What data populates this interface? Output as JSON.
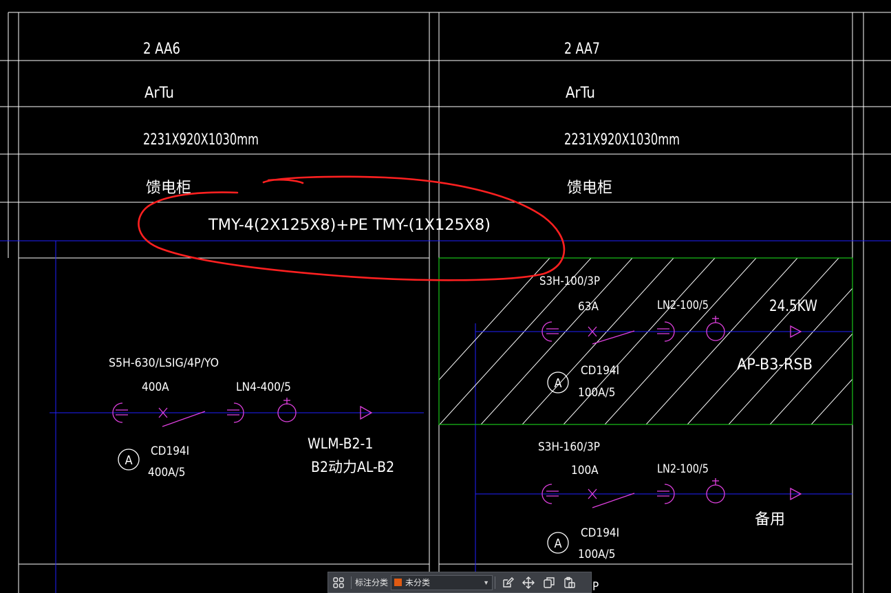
{
  "drawing": {
    "cabinet_ids": [
      "2 AA6",
      "2 AA7"
    ],
    "types": [
      "ArTu",
      "ArTu"
    ],
    "dimensions": [
      "2231X920X1030mm",
      "2231X920X1030mm"
    ],
    "functions": [
      "馈电柜",
      "馈电柜"
    ],
    "busbar_spec": "TMY-4(2X125X8)+PE TMY-(1X125X8)",
    "circuit_left": {
      "breaker": "S5H-630/LSIG/4P/YO",
      "current": "400A",
      "ct": "LN4-400/5",
      "meter_symbol": "A",
      "meter_model": "CD194I",
      "meter_ratio": "400A/5",
      "feeder": "WLM-B2-1",
      "destination": "B2动力AL-B2"
    },
    "circuit_right_1": {
      "breaker": "S3H-100/3P",
      "current": "63A",
      "ct": "LN2-100/5",
      "power": "24.5KW",
      "meter_symbol": "A",
      "meter_model": "CD194I",
      "meter_ratio": "100A/5",
      "destination": "AP-B3-RSB"
    },
    "circuit_right_2": {
      "breaker": "S3H-160/3P",
      "current": "100A",
      "ct": "LN2-100/5",
      "meter_symbol": "A",
      "meter_model": "CD194I",
      "meter_ratio": "100A/5",
      "destination": "备用"
    },
    "partial_text": "P",
    "colors": {
      "background": "#000000",
      "grid": "#ffffff",
      "wire": "#2020ff",
      "symbol": "#e040e0",
      "hatch_border": "#19c419",
      "markup": "#ff2020"
    }
  },
  "toolbar": {
    "grid_icon": "grid-icon",
    "category_label": "标注分类",
    "category_value": "未分类",
    "swatch_color": "#e05a12",
    "tools": [
      "edit-icon",
      "move-icon",
      "copy-icon",
      "paste-icon"
    ]
  }
}
